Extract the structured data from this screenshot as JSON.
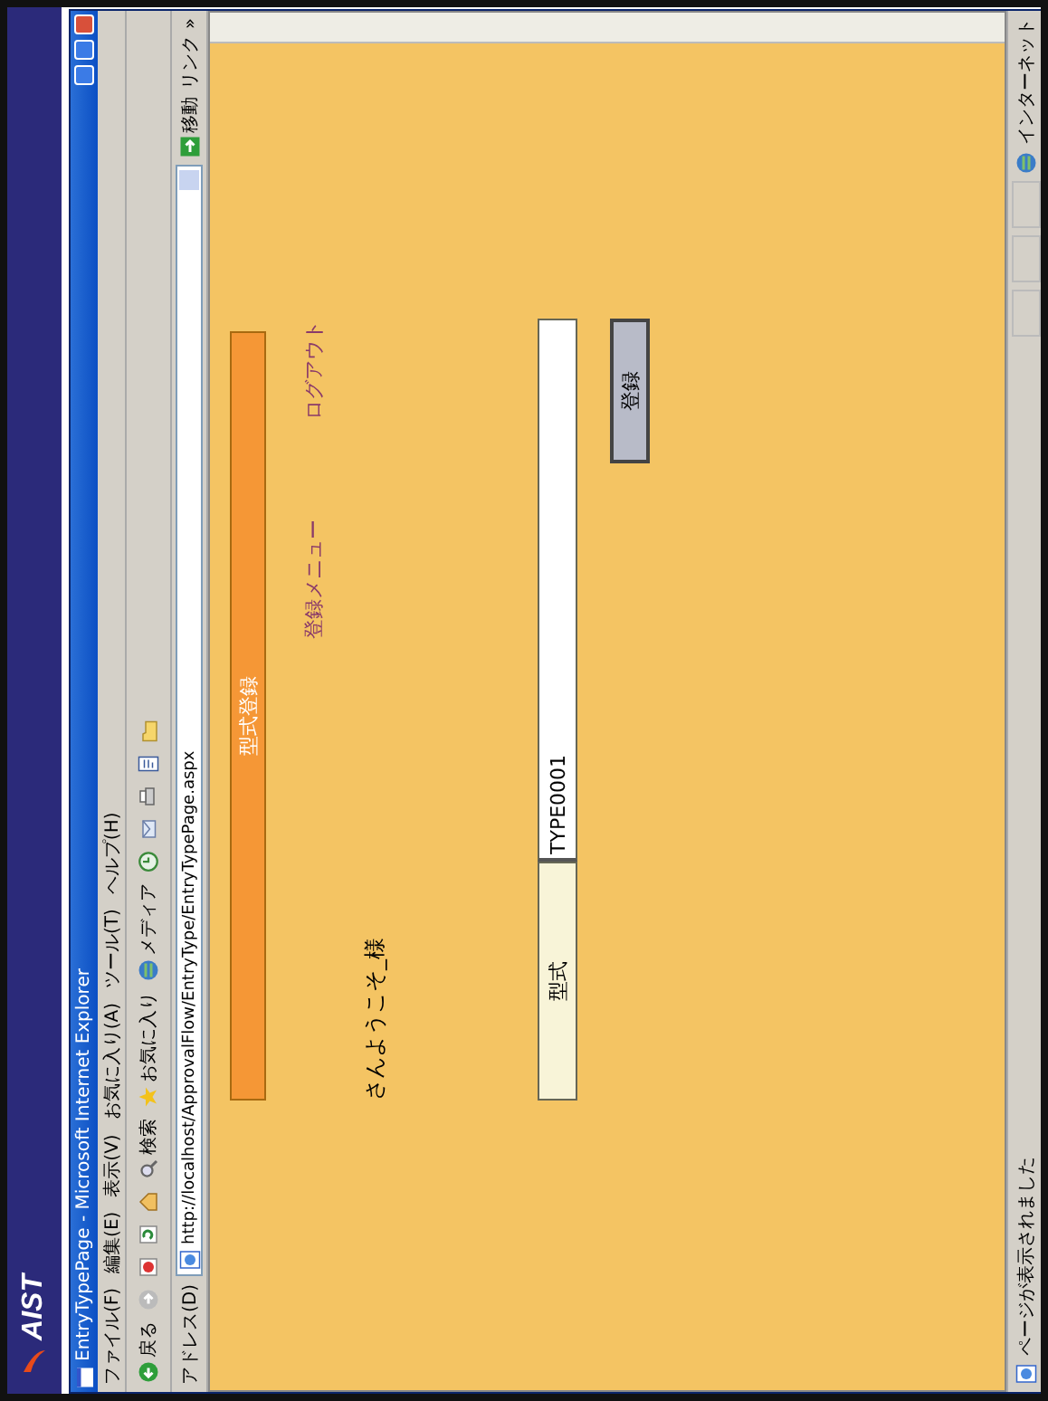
{
  "slide": {
    "logo": "AIST"
  },
  "window": {
    "title": "EntryTypePage - Microsoft Internet Explorer"
  },
  "menu": [
    "ファイル(F)",
    "編集(E)",
    "表示(V)",
    "お気に入り(A)",
    "ツール(T)",
    "ヘルプ(H)"
  ],
  "toolbar": [
    {
      "kind": "back",
      "label": "戻る"
    },
    {
      "kind": "forward"
    },
    {
      "kind": "stop"
    },
    {
      "kind": "refresh"
    },
    {
      "kind": "home"
    },
    {
      "kind": "search",
      "label": "検索"
    },
    {
      "kind": "favorites",
      "label": "お気に入り"
    },
    {
      "kind": "media",
      "label": "メディア"
    },
    {
      "kind": "history"
    },
    {
      "kind": "mail"
    },
    {
      "kind": "print"
    },
    {
      "kind": "edit"
    },
    {
      "kind": "folder"
    }
  ],
  "address_bar": {
    "label": "アドレス(D)",
    "value": "http://localhost/ApprovalFlow/EntryType/EntryTypePage.aspx",
    "go": "移動",
    "links": "リンク »"
  },
  "page": {
    "side_menu": [
      {
        "label": "型式登録",
        "selected": true
      }
    ],
    "nav_links": [
      "登録メニュー",
      "ログアウト"
    ],
    "greeting": "さんようこそ_様",
    "form": {
      "label": "型式",
      "value": "TYPE0001",
      "button": "登録"
    }
  },
  "status_bar": {
    "message": "ページが表示されました",
    "zone": "インターネット"
  }
}
